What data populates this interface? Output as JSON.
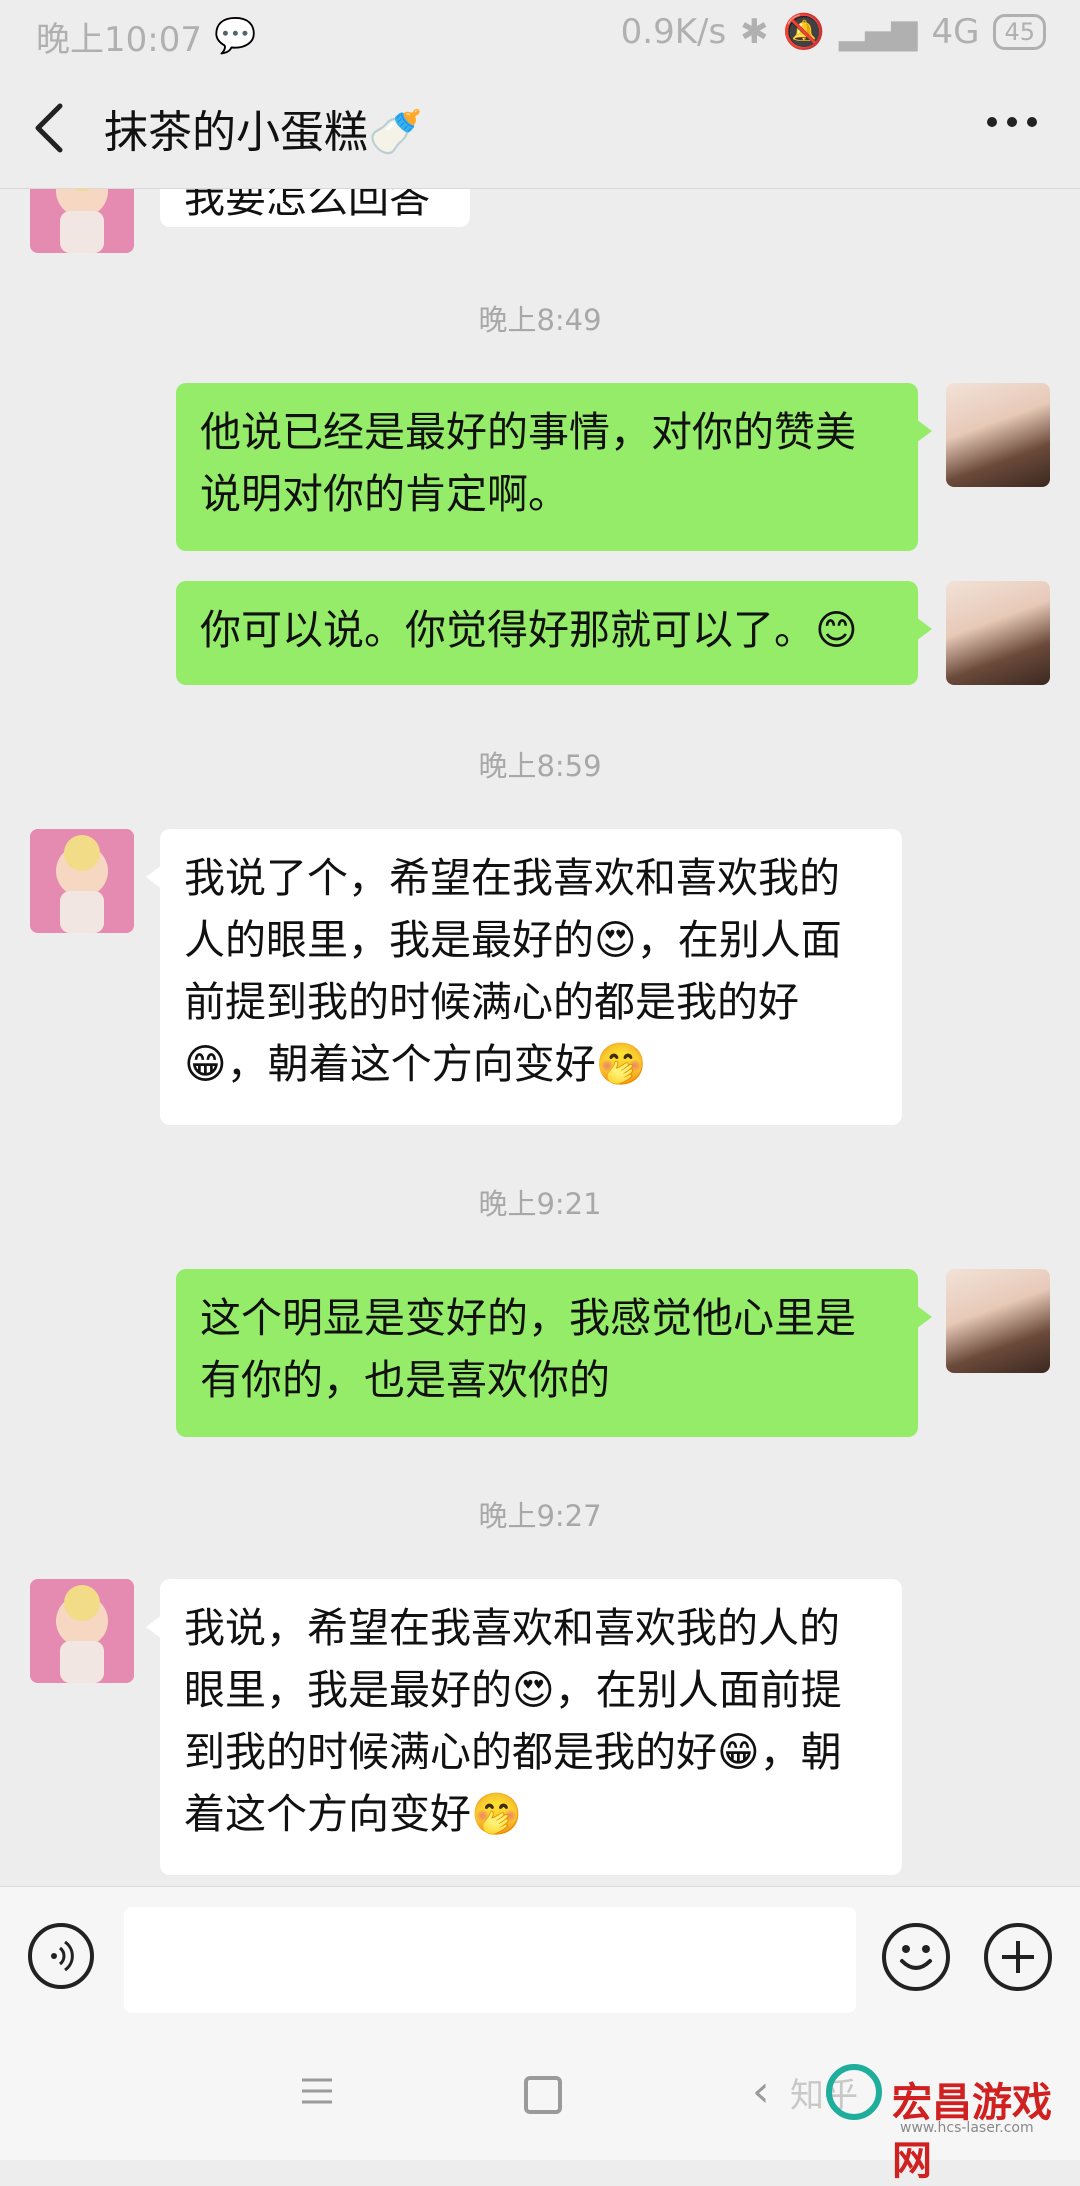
{
  "status_bar": {
    "time": "晚上10:07",
    "network_speed": "0.9K/s",
    "network": "4G",
    "battery": "45"
  },
  "header": {
    "title": "抹茶的小蛋糕🍼"
  },
  "messages": [
    {
      "type": "partial_text",
      "side": "left",
      "text": "我要怎么回答"
    },
    {
      "type": "timestamp",
      "text": "晚上8:49"
    },
    {
      "type": "text",
      "side": "right",
      "text": "他说已经是最好的事情，对你的赞美\n说明对你的肯定啊。"
    },
    {
      "type": "text",
      "side": "right",
      "text": "你可以说。你觉得好那就可以了。😊"
    },
    {
      "type": "timestamp",
      "text": "晚上8:59"
    },
    {
      "type": "text",
      "side": "left",
      "text": "我说了个，希望在我喜欢和喜欢我的\n人的眼里，我是最好的😍，在别人面\n前提到我的时候满心的都是我的好\n😁，朝着这个方向变好🤭"
    },
    {
      "type": "timestamp",
      "text": "晚上9:21"
    },
    {
      "type": "text",
      "side": "right",
      "text": "这个明显是变好的，我感觉他心里是\n有你的，也是喜欢你的"
    },
    {
      "type": "timestamp",
      "text": "晚上9:27"
    },
    {
      "type": "text",
      "side": "left",
      "text": "我说，希望在我喜欢和喜欢我的人的\n眼里，我是最好的😍，在别人面前提\n到我的时候满心的都是我的好😁，朝\n着这个方向变好🤭"
    }
  ],
  "input_bar": {
    "placeholder": "",
    "icons": [
      "voice-icon",
      "emoji-icon",
      "plus-icon"
    ]
  },
  "watermark": {
    "zhihu": "知乎",
    "site": "宏昌游戏网",
    "site_url": "www.hcs-laser.com"
  },
  "colors": {
    "background": "#ededed",
    "bubble_me": "#95ec69",
    "bubble_other": "#ffffff"
  }
}
